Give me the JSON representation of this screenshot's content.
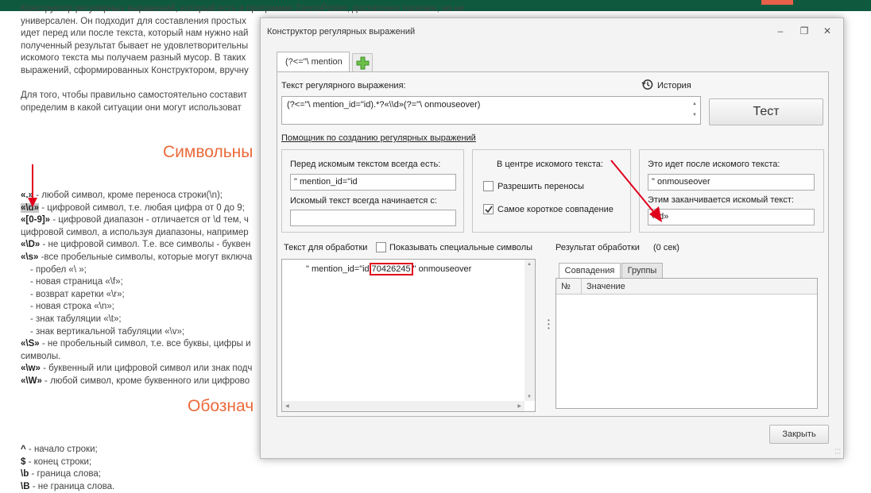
{
  "background_page": {
    "intro_lines": [
      "Конструктор регулярных выражений, который есть в программе ZennoPoster, достаточно полезен, но не",
      "универсален. Он подходит для составления простых",
      "идет перед или после  текста, который нам нужно най",
      "полученный результат бывает не удовлетворительны",
      "искомого текста мы получаем разный мусор. В таких",
      "выражений, сформированных Конструктором, вручну"
    ],
    "para2_lines": [
      "Для того, чтобы правильно самостоятельно составит",
      "определим в какой ситуации они могут использоват"
    ],
    "section1_title": "Символьны",
    "symbols": [
      {
        "code": "«.»",
        "text": " - любой символ, кроме переноса строки(\\n);",
        "highlight": false,
        "indent": false
      },
      {
        "code": "«\\d»",
        "text": " - цифровой символ, т.е. любая цифра от 0 до 9;",
        "highlight": true,
        "indent": false
      },
      {
        "code": "«[0-9]»",
        "text": " - цифровой диапазон - отличается от \\d тем, ч",
        "highlight": false,
        "indent": false
      },
      {
        "code": "",
        "text": "цифровой символ, а используя диапазоны, например",
        "highlight": false,
        "indent": false
      },
      {
        "code": "«\\D»",
        "text": " - не цифровой символ. Т.е. все символы - буквен",
        "highlight": false,
        "indent": false
      },
      {
        "code": "«\\s»",
        "text": " -все пробельные символы, которые могут включа",
        "highlight": false,
        "indent": false
      },
      {
        "code": "",
        "text": "- пробел «\\ »;",
        "highlight": false,
        "indent": true
      },
      {
        "code": "",
        "text": "- новая страница «\\f»;",
        "highlight": false,
        "indent": true
      },
      {
        "code": "",
        "text": "- возврат каретки «\\r»;",
        "highlight": false,
        "indent": true
      },
      {
        "code": "",
        "text": "- новая строка «\\n»;",
        "highlight": false,
        "indent": true
      },
      {
        "code": "",
        "text": "- знак табуляции «\\t»;",
        "highlight": false,
        "indent": true
      },
      {
        "code": "",
        "text": "- знак вертикальной табуляции «\\v»;",
        "highlight": false,
        "indent": true
      },
      {
        "code": "«\\S»",
        "text": " - не пробельный символ, т.е. все буквы, цифры и",
        "highlight": false,
        "indent": false
      },
      {
        "code": "",
        "text": "символы.",
        "highlight": false,
        "indent": false
      },
      {
        "code": "«\\w»",
        "text": " - буквенный или цифровой символ или знак подч",
        "highlight": false,
        "indent": false
      },
      {
        "code": "«\\W»",
        "text": " - любой символ, кроме буквенного или цифрово",
        "highlight": false,
        "indent": false
      }
    ],
    "section2_title": "Обознач",
    "anchors": [
      {
        "code": "^",
        "text": " - начало строки;"
      },
      {
        "code": "$",
        "text": " - конец строки;"
      },
      {
        "code": "\\b",
        "text": " - граница слова;"
      },
      {
        "code": "\\B",
        "text": " - не граница слова."
      }
    ]
  },
  "dialog": {
    "title": "Конструктор регулярных выражений",
    "tab_label": "(?<=\"\\ mention",
    "regex_label": "Текст регулярного выражения:",
    "history_label": "История",
    "regex_value": "(?<=\"\\ mention_id=\"id).*?«\\\\d»(?=\"\\ onmouseover)",
    "test_button": "Тест",
    "helper_link": "Помощник по созданию регулярных выражений",
    "before_label": "Перед искомым текстом всегда есть:",
    "before_value": "\" mention_id=\"id",
    "starts_label": "Искомый текст всегда начинается с:",
    "starts_value": "",
    "center_label": "В центре искомого текста:",
    "allow_wrap_label": "Разрешить переносы",
    "allow_wrap_checked": false,
    "shortest_label": "Самое короткое совпадение",
    "shortest_checked": true,
    "after_label": "Это идет после искомого текста:",
    "after_value": "\" onmouseover",
    "ends_label": "Этим заканчивается искомый текст:",
    "ends_value": "«\\d»",
    "process_text_label": "Текст для обработки",
    "show_special_label": "Показывать специальные символы",
    "show_special_checked": false,
    "process_text_before": "\" mention_id=\"id",
    "process_text_match": "70426245",
    "process_text_after": "\" onmouseover",
    "result_label": "Результат обработки",
    "result_time": "(0 сек)",
    "tab_matches": "Совпадения",
    "tab_groups": "Группы",
    "col_num": "№",
    "col_value": "Значение",
    "close_button": "Закрыть"
  },
  "colors": {
    "accent_orange": "#ea6a3a",
    "annotation_red": "#e0001b",
    "header_green": "#0f5a3e",
    "add_icon_green": "#6cc04a"
  },
  "icons": [
    "history-clock-icon",
    "add-tab-plus-icon",
    "minimize-icon",
    "restore-icon",
    "close-icon",
    "check-icon"
  ]
}
